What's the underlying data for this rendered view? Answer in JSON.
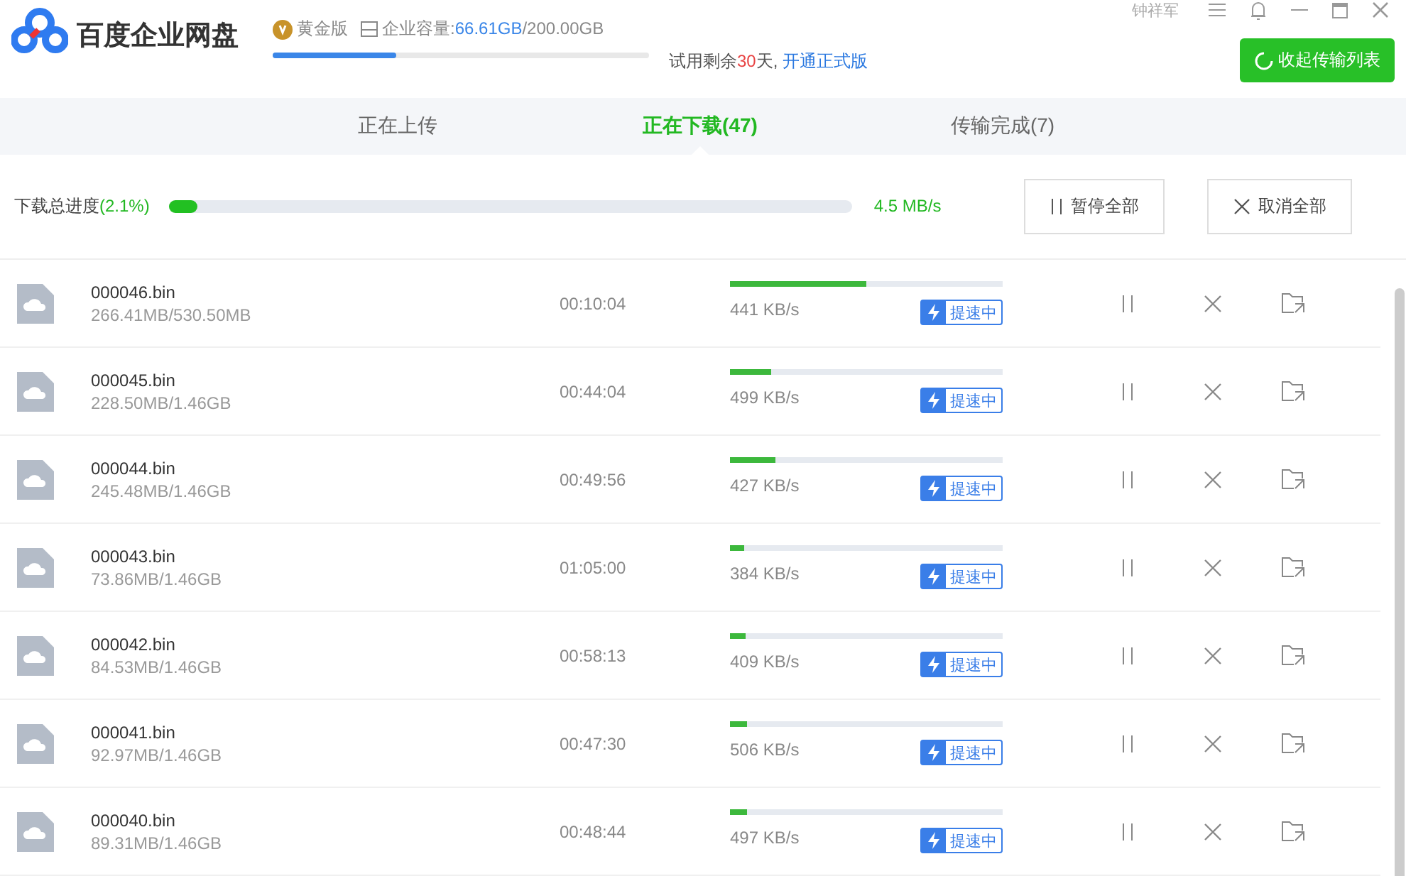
{
  "app": {
    "name": "百度企业网盘",
    "edition": "黄金版",
    "capacity": {
      "label": "企业容量:",
      "used": "66.61GB",
      "total": "/200.00GB",
      "level": 0.33
    },
    "trial_prefix": "试用剩余",
    "trial_days": "30",
    "trial_suffix": "天,",
    "upgrade_link": "开通正式版",
    "user": "钟祥军",
    "collapse_button": "收起传输列表"
  },
  "tabs": [
    {
      "label": "正在上传",
      "selected": false
    },
    {
      "label": "正在下载(47)",
      "selected": true
    },
    {
      "label": "传输完成(7)",
      "selected": false
    }
  ],
  "overall": {
    "label": "下载总进度",
    "percent": "(2.1%)",
    "level": 0.021,
    "speed": "4.5 MB/s",
    "pause_all": "暂停全部",
    "cancel_all": "取消全部"
  },
  "files": [
    {
      "name": "000046.bin",
      "size": "266.41MB/530.50MB",
      "time": "00:10:04",
      "level": 0.5,
      "speed": "441 KB/s",
      "badge": "提速中"
    },
    {
      "name": "000045.bin",
      "size": "228.50MB/1.46GB",
      "time": "00:44:04",
      "level": 0.15,
      "speed": "499 KB/s",
      "badge": "提速中"
    },
    {
      "name": "000044.bin",
      "size": "245.48MB/1.46GB",
      "time": "00:49:56",
      "level": 0.165,
      "speed": "427 KB/s",
      "badge": "提速中"
    },
    {
      "name": "000043.bin",
      "size": "73.86MB/1.46GB",
      "time": "01:05:00",
      "level": 0.05,
      "speed": "384 KB/s",
      "badge": "提速中"
    },
    {
      "name": "000042.bin",
      "size": "84.53MB/1.46GB",
      "time": "00:58:13",
      "level": 0.058,
      "speed": "409 KB/s",
      "badge": "提速中"
    },
    {
      "name": "000041.bin",
      "size": "92.97MB/1.46GB",
      "time": "00:47:30",
      "level": 0.064,
      "speed": "506 KB/s",
      "badge": "提速中"
    },
    {
      "name": "000040.bin",
      "size": "89.31MB/1.46GB",
      "time": "00:48:44",
      "level": 0.061,
      "speed": "497 KB/s",
      "badge": "提速中"
    }
  ]
}
